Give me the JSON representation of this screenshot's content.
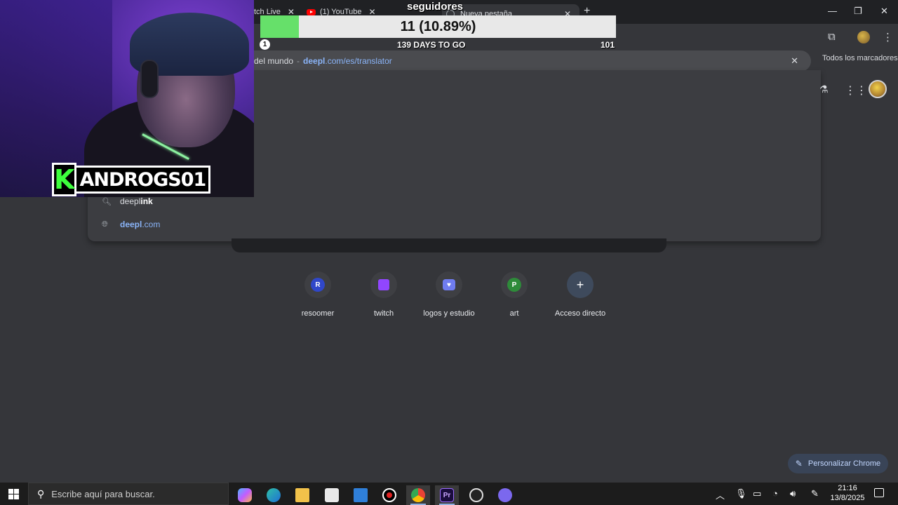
{
  "browser": {
    "tabs": [
      {
        "label": "tch Live"
      },
      {
        "label": "(1) YouTube"
      },
      {
        "label": "Nueva pestaña"
      }
    ],
    "omnibox": {
      "path_text": "del mundo",
      "separator": "-",
      "domain": "deepl",
      "rest": ".com/es/translator"
    },
    "bookmarks_label": "Todos los marcadores",
    "suggestions": [
      {
        "typed": "deepl",
        "completion": "ink"
      },
      {
        "url_bold": "deepl",
        "url_rest": ".com"
      }
    ]
  },
  "shortcuts": [
    {
      "label": "resoomer",
      "letter": "R",
      "color": "#3047c9"
    },
    {
      "label": "twitch",
      "letter": "",
      "color": "#9146ff"
    },
    {
      "label": "logos y estudio",
      "letter": "",
      "color": "#6f7cf0"
    },
    {
      "label": "art",
      "letter": "P",
      "color": "#2e8b3a"
    },
    {
      "label": "Acceso directo",
      "letter": "+",
      "color": "#3e4a5c"
    }
  ],
  "customize_label": "Personalizar Chrome",
  "stream_overlay": {
    "goal_title": "seguidores",
    "goal_count": "11 (10.89%)",
    "goal_progress": 0.1089,
    "goal_start": "1",
    "goal_days": "139 DAYS TO GO",
    "goal_target": "101",
    "badge_letter": "K",
    "badge_name": "ANDROGS01",
    "accent_color": "#66e06a"
  },
  "taskbar": {
    "search_placeholder": "Escribe aquí para buscar.",
    "time": "21:16",
    "date": "13/8/2025"
  }
}
